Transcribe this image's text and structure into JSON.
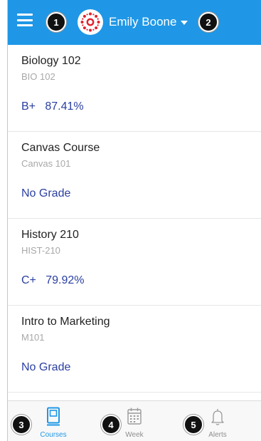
{
  "header": {
    "user_name": "Emily Boone",
    "background_color": "#1f97e6"
  },
  "callouts": [
    "1",
    "2",
    "3",
    "4",
    "5"
  ],
  "courses": [
    {
      "name": "Biology 102",
      "code": "BIO 102",
      "grade": "B+   87.41%"
    },
    {
      "name": "Canvas Course",
      "code": "Canvas 101",
      "grade": "No Grade"
    },
    {
      "name": "History 210",
      "code": "HIST-210",
      "grade": "C+   79.92%"
    },
    {
      "name": "Intro to Marketing",
      "code": "M101",
      "grade": "No Grade"
    }
  ],
  "tabs": [
    {
      "label": "Courses",
      "icon": "courses-icon",
      "active": true
    },
    {
      "label": "Week",
      "icon": "calendar-icon",
      "active": false
    },
    {
      "label": "Alerts",
      "icon": "bell-icon",
      "active": false
    }
  ],
  "colors": {
    "accent": "#1f97e6",
    "grade_text": "#2a3fa0",
    "logo_red": "#e4202c"
  }
}
